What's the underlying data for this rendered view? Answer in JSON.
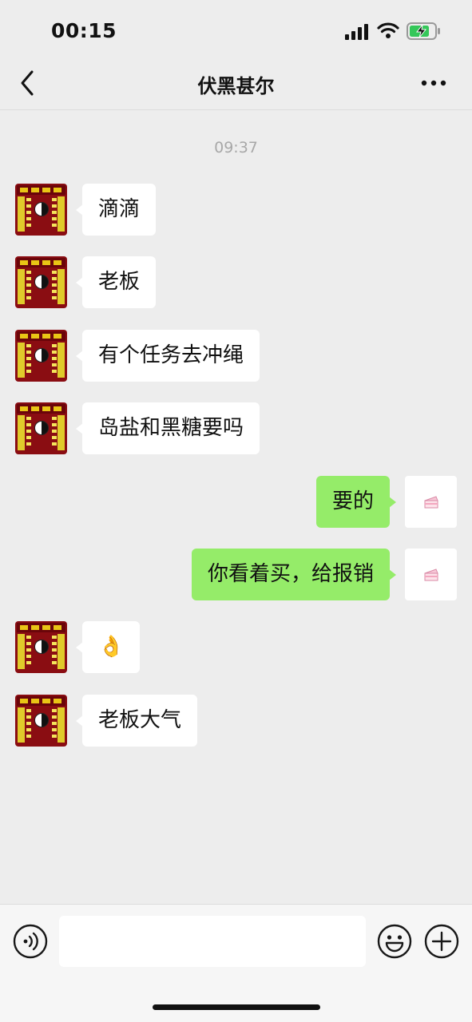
{
  "status_bar": {
    "time": "00:15",
    "icons": [
      "signal-icon",
      "wifi-icon",
      "battery-charging-icon"
    ]
  },
  "header": {
    "title": "伏黑甚尔",
    "back_icon": "chevron-left-icon",
    "more_icon": "ellipsis-icon"
  },
  "chat": {
    "timestamp": "09:37",
    "messages": [
      {
        "sender": "other",
        "text": "滴滴"
      },
      {
        "sender": "other",
        "text": "老板"
      },
      {
        "sender": "other",
        "text": "有个任务去冲绳"
      },
      {
        "sender": "other",
        "text": "岛盐和黑糖要吗"
      },
      {
        "sender": "self",
        "text": "要的"
      },
      {
        "sender": "self",
        "text": "你看着买，给报销"
      },
      {
        "sender": "other",
        "text": "👌"
      },
      {
        "sender": "other",
        "text": "老板大气"
      }
    ]
  },
  "input_bar": {
    "value": "",
    "icons": [
      "voice-icon",
      "emoji-icon",
      "plus-icon"
    ]
  },
  "colors": {
    "background": "#ededed",
    "bubble_self": "#95ec69",
    "bubble_other": "#ffffff",
    "avatar_other": "#8a0d12"
  }
}
